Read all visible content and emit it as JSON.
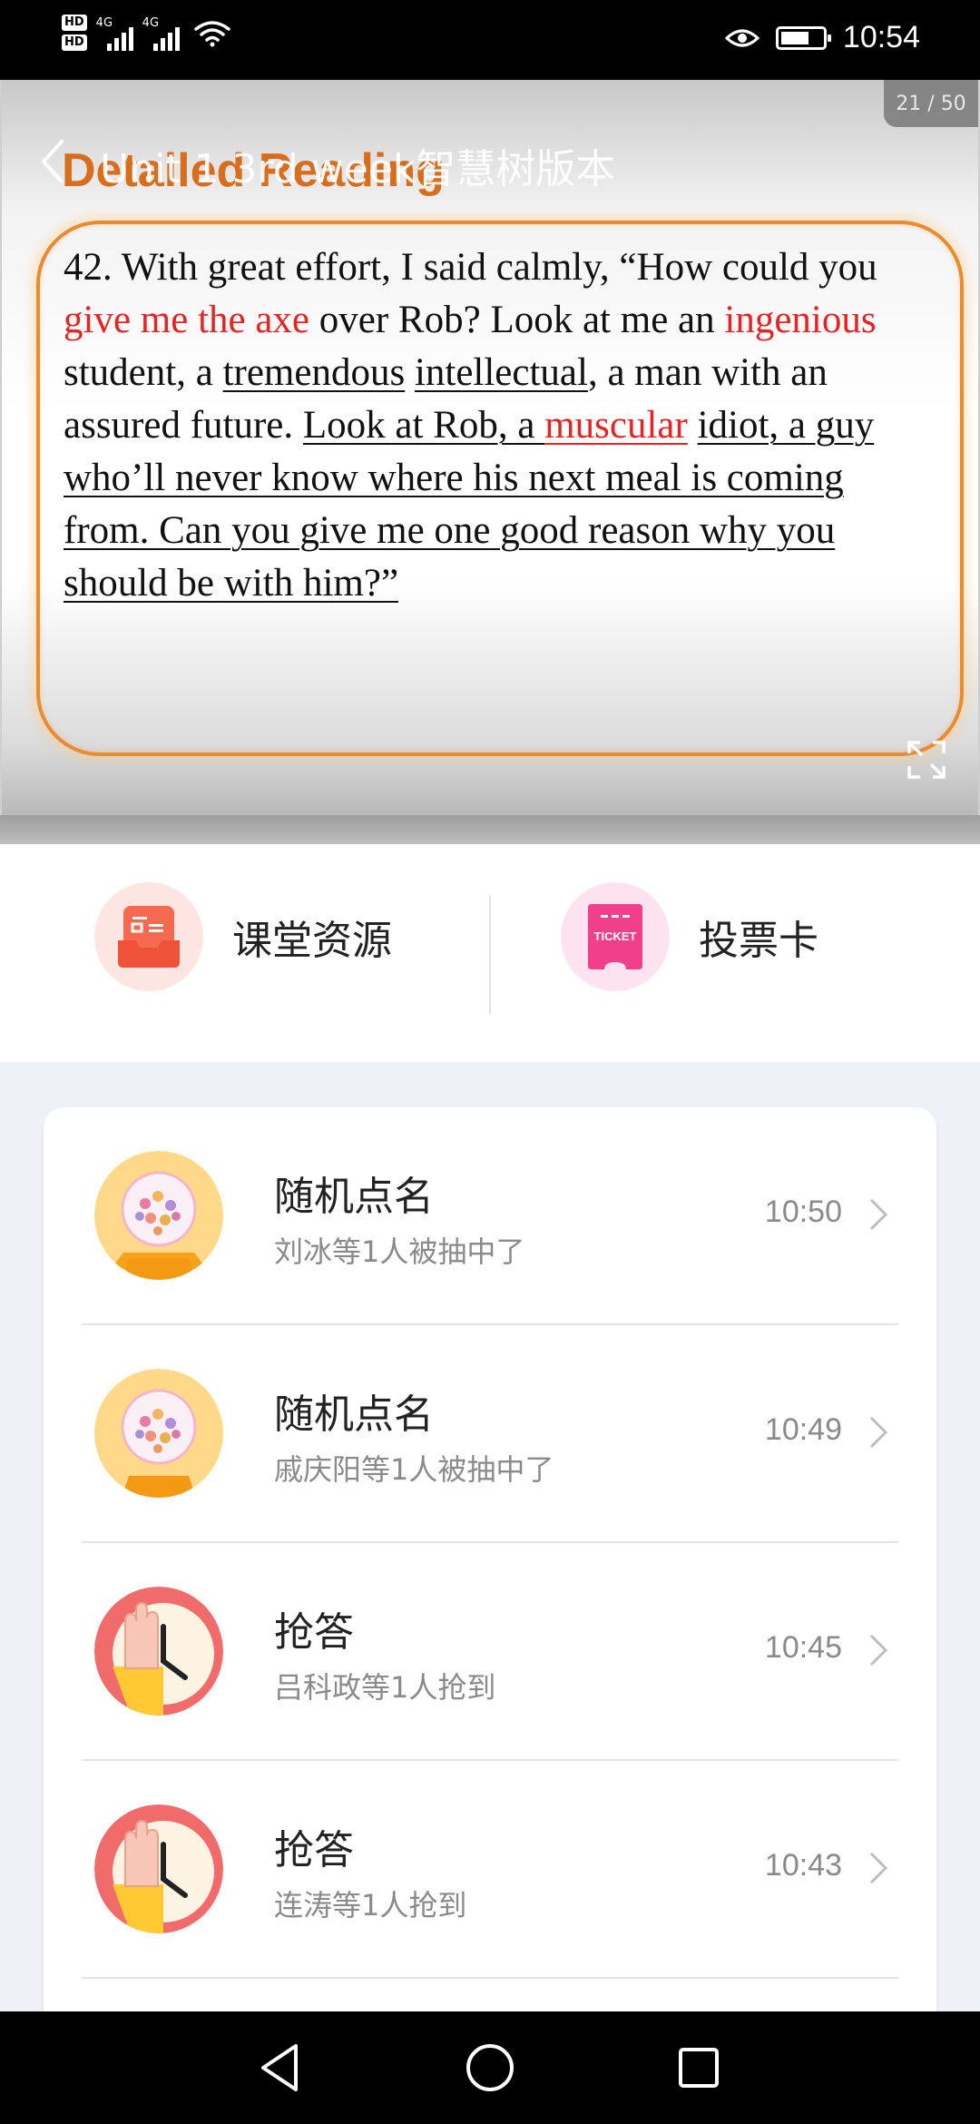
{
  "status_bar": {
    "hd_labels": [
      "HD",
      "HD"
    ],
    "network_labels": [
      "4G",
      "4G"
    ],
    "time": "10:54"
  },
  "slide": {
    "page_counter": "21 / 50",
    "doc_title": "Unit 1 3rd week智慧树版本",
    "heading": "Detailed Reading",
    "passage": {
      "p1": "42. With great effort, I said calmly, “How could you ",
      "p2": "give me the axe",
      "p3": " over Rob? Look at me an ",
      "p4": "ingenious",
      "p5": " student, a ",
      "p6": "tremendous",
      "p7": " ",
      "p8": "intellectual",
      "p9": ", a man with an assured future. ",
      "p10": "Look at Rob, a ",
      "p11": "muscular",
      "p12": " ",
      "p13": "idiot, a guy who’ll never know where his next meal is coming from. Can you give me one good reason why you should be with him?”"
    },
    "accent_color": "#e98b2e",
    "highlight_color": "#e62424"
  },
  "tools": {
    "resources_label": "课堂资源",
    "vote_label": "投票卡",
    "ticket_text": "TICKET"
  },
  "activities": [
    {
      "title": "随机点名",
      "subtitle": "刘冰等1人被抽中了",
      "time": "10:50",
      "icon": "lottery-globe-icon"
    },
    {
      "title": "随机点名",
      "subtitle": "戚庆阳等1人被抽中了",
      "time": "10:49",
      "icon": "lottery-globe-icon"
    },
    {
      "title": "抢答",
      "subtitle": "吕科政等1人抢到",
      "time": "10:45",
      "icon": "raised-hand-clock-icon"
    },
    {
      "title": "抢答",
      "subtitle": "连涛等1人抢到",
      "time": "10:43",
      "icon": "raised-hand-clock-icon"
    }
  ]
}
